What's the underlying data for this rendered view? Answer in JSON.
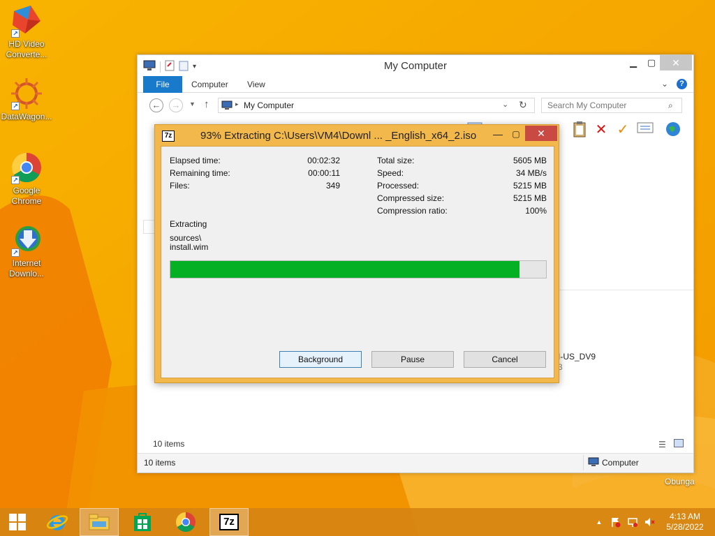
{
  "desktop": {
    "icons": [
      {
        "label": "HD Video Converte..."
      },
      {
        "label": "DataWagon..."
      },
      {
        "label": "Google Chrome"
      },
      {
        "label": "Internet Downlo..."
      }
    ],
    "username": "Obunga"
  },
  "explorer": {
    "title": "My Computer",
    "tabs": [
      "File",
      "Computer",
      "View"
    ],
    "address": "My Computer",
    "search_placeholder": "Search My Computer",
    "items_inner": "10 items",
    "status_left": "10 items",
    "status_right": "Computer",
    "partial_text_1": "I-US_DV9",
    "partial_text_2": "3"
  },
  "dialog": {
    "title": "93% Extracting C:\\Users\\VM4\\Downl ... _English_x64_2.iso",
    "left_stats": [
      {
        "label": "Elapsed time:",
        "value": "00:02:32"
      },
      {
        "label": "Remaining time:",
        "value": "00:00:11"
      },
      {
        "label": "Files:",
        "value": "349"
      }
    ],
    "right_stats": [
      {
        "label": "Total size:",
        "value": "5605 MB"
      },
      {
        "label": "Speed:",
        "value": "34 MB/s"
      },
      {
        "label": "Processed:",
        "value": "5215 MB"
      },
      {
        "label": "Compressed size:",
        "value": "5215 MB"
      },
      {
        "label": "Compression ratio:",
        "value": "100%"
      }
    ],
    "action": "Extracting",
    "path_line1": "sources\\",
    "path_line2": "install.wim",
    "progress_fraction": 0.93,
    "progress_color": "#06b025",
    "buttons": {
      "background": "Background",
      "pause": "Pause",
      "cancel": "Cancel"
    }
  },
  "taskbar": {
    "time": "4:13 AM",
    "date": "5/28/2022"
  }
}
